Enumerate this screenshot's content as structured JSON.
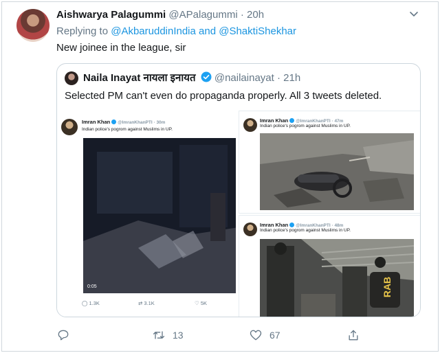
{
  "tweet": {
    "display_name": "Aishwarya Palagummi",
    "handle": "@APalagummi",
    "separator": "·",
    "time": "20h",
    "replying_prefix": "Replying to",
    "reply_handle_1": "@AkbaruddinIndia",
    "reply_and": "and",
    "reply_handle_2": "@ShaktiShekhar",
    "text": "New joinee in the league, sir",
    "reply_count": "",
    "retweet_count": "13",
    "like_count": "67"
  },
  "quoted": {
    "display_name": "Naila Inayat नायला इनायत",
    "handle": "@nailainayat",
    "separator": "·",
    "time": "21h",
    "text": "Selected PM can't even do propaganda properly. All 3 tweets deleted.",
    "left_shot": {
      "name": "Imran Khan",
      "handle": "@ImranKhanPTI · 30m",
      "text": "Indian police's pogrom against Muslims in UP.",
      "video_time": "0:05",
      "replies": "1.3K",
      "retweets": "3.1K",
      "likes": "5K"
    },
    "top_right_shot": {
      "name": "Imran Khan",
      "handle": "@ImranKhanPTI · 47m",
      "text": "Indian police's pogrom against Muslims in UP."
    },
    "bottom_right_shot": {
      "name": "Imran Khan",
      "handle": "@ImranKhanPTI · 48m",
      "text": "Indian police's pogrom against Muslims in UP.",
      "shield_text": "RAB"
    }
  },
  "colors": {
    "link": "#1b95e0",
    "muted": "#657786",
    "verified": "#1da1f2"
  },
  "icons": [
    "chevron-down-icon",
    "verified-badge-icon",
    "reply-icon",
    "retweet-icon",
    "like-icon",
    "share-icon"
  ]
}
